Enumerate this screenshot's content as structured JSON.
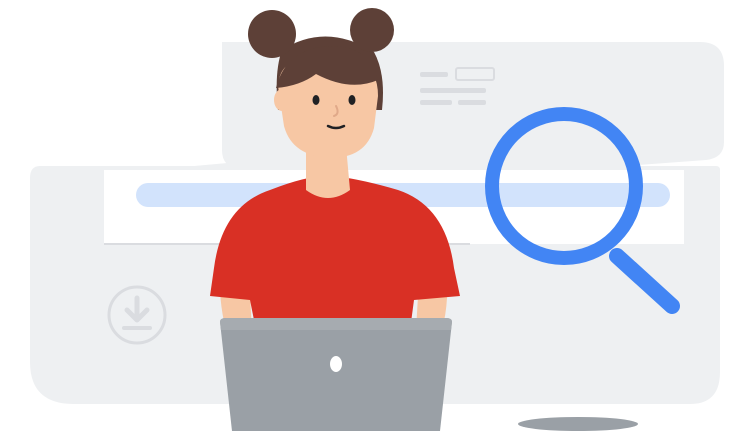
{
  "illustration": {
    "subject": "person-using-laptop-with-search",
    "icons": [
      "download-icon",
      "search-magnifier-icon",
      "laptop-logo-icon"
    ],
    "colors": {
      "background_panel": "#eef0f2",
      "background_panel_edge": "#e4e6e8",
      "search_bar": "#d2e3fc",
      "search_ring": "#4285f4",
      "shirt": "#d93025",
      "skin": "#f7c7a4",
      "hair": "#5d4037",
      "laptop": "#9aa0a6",
      "laptop_dark": "#80868b",
      "shadow": "#9aa0a6",
      "wireframe_lines": "#dadce0"
    }
  }
}
